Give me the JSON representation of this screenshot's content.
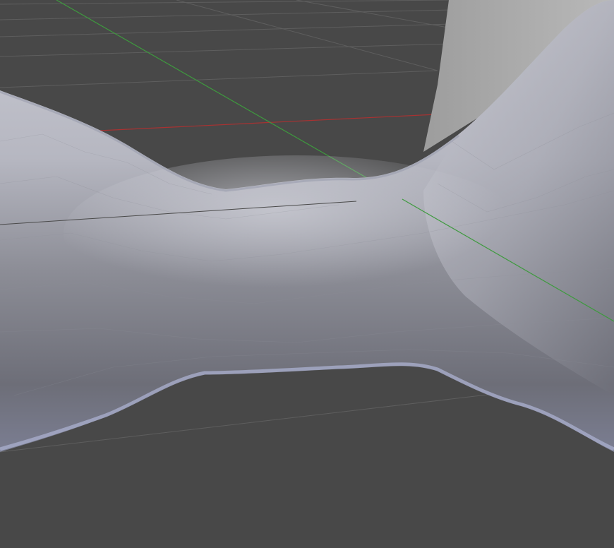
{
  "viewport": {
    "background_color": "#484848",
    "grid_color": "#5e5e5e",
    "x_axis_color": "#a83232",
    "y_axis_color": "#3e9a3e",
    "mesh": {
      "highlight_color": "#c4c5cf",
      "mid_color": "#9fa0a9",
      "shadow_color": "#6b6c75",
      "rim_color": "#a8acca",
      "background_mesh_color": "#a3a3a3"
    }
  }
}
